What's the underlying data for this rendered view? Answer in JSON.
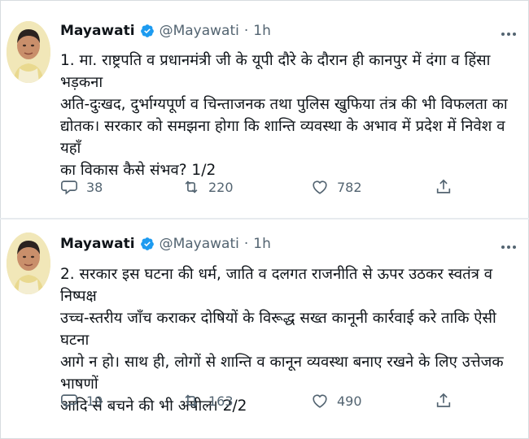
{
  "tweets": [
    {
      "author": "Mayawati",
      "handle": "@Mayawati",
      "separator": "·",
      "time": "1h",
      "text": "1. मा. राष्ट्रपति व प्रधानमंत्री जी के यूपी दौरे के दौरान ही कानपुर में दंगा व हिंसा भड़कना\nअति-दुःखद, दुर्भाग्यपूर्ण व चिन्ताजनक तथा पुलिस खुफिया तंत्र की भी विफलता का\nद्योतक। सरकार को समझना होगा कि शान्ति व्यवस्था के अभाव में प्रदेश में निवेश व यहाँ\nका विकास कैसे संभव? 1/2",
      "replies": "38",
      "retweets": "220",
      "likes": "782"
    },
    {
      "author": "Mayawati",
      "handle": "@Mayawati",
      "separator": "·",
      "time": "1h",
      "text": "2. सरकार इस घटना की धर्म, जाति व दलगत राजनीति से ऊपर उठकर स्वतंत्र व निष्पक्ष\nउच्च-स्तरीय जाँच कराकर दोषियों के विरूद्ध सख्त कानूनी कार्रवाई करे ताकि ऐसी घटना\nआगे न हो। साथ ही, लोगों से शान्ति व कानून व्यवस्था बनाए रखने के लिए उत्तेजक भाषणों\nआदि से बचने की भी अपील। 2/2",
      "replies": "19",
      "retweets": "163",
      "likes": "490"
    }
  ],
  "icons": {
    "verified": "verified-badge-icon",
    "more": "more-options-icon",
    "reply": "reply-icon",
    "retweet": "retweet-icon",
    "like": "like-icon",
    "share": "share-icon"
  },
  "colors": {
    "verified": "#1d9bf0",
    "muted": "#536471",
    "text": "#0f1419"
  }
}
